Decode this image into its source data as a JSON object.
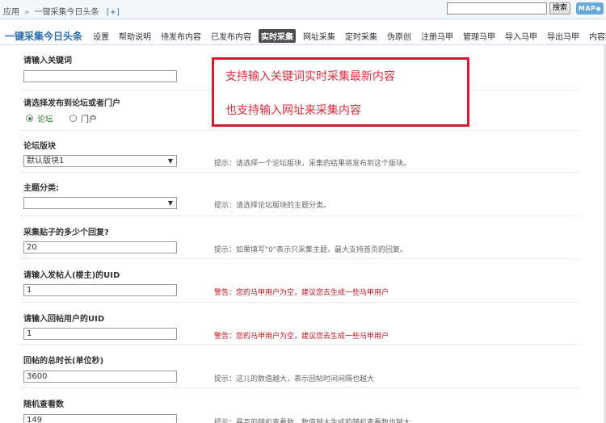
{
  "topbar": {
    "breadcrumb_root": "应用",
    "breadcrumb_sep": "»",
    "breadcrumb_current": "一键采集今日头条",
    "breadcrumb_plus": "[+]",
    "search_button": "搜索",
    "map_button": "MAP◆"
  },
  "nav": {
    "title": "一键采集今日头条",
    "items": [
      "设置",
      "帮助说明",
      "待发布内容",
      "已发布内容",
      "实时采集",
      "网址采集",
      "定时采集",
      "伪原创",
      "注册马甲",
      "管理马甲",
      "导入马甲",
      "导出马甲",
      "内容回收站"
    ],
    "active": "实时采集"
  },
  "callout": {
    "line1": "支持输入关键词实时采集最新内容",
    "line2": "也支持输入网址来采集内容"
  },
  "form": {
    "keyword_label": "请输入关键词",
    "keyword_value": "",
    "publish_label": "请选择发布到论坛或者门户",
    "radio_forum": "论坛",
    "radio_portal": "门户",
    "board_label": "论坛版块",
    "board_value": "默认版块1",
    "board_hint": "提示：请选择一个论坛版块，采集的结果将发布到这个版块。",
    "topic_label": "主题分类:",
    "topic_value": "",
    "topic_hint": "提示：请选择论坛版块的主题分类。",
    "replies_label": "采集贴子的多少个回复?",
    "replies_value": "20",
    "replies_hint": "提示：如果填写\"0\"表示只采集主题，最大支持首页的回复。",
    "poster_uid_label": "请输入发帖人(楼主)的UID",
    "poster_uid_value": "1",
    "poster_uid_warn": "警告：您的马甲用户为空，建议您去生成一些马甲用户",
    "reply_uid_label": "请输入回帖用户的UID",
    "reply_uid_value": "1",
    "reply_uid_warn": "警告：您的马甲用户为空，建议您去生成一些马甲用户",
    "duration_label": "回帖的总时长(单位秒)",
    "duration_value": "3600",
    "duration_hint": "提示：这儿的数值越大，表示回帖时间间隔也越大",
    "views_label": "随机查看数",
    "views_value": "149",
    "views_hint": "提示：最高的随机查看数，数值越大生成的随机查看数也越大。"
  }
}
